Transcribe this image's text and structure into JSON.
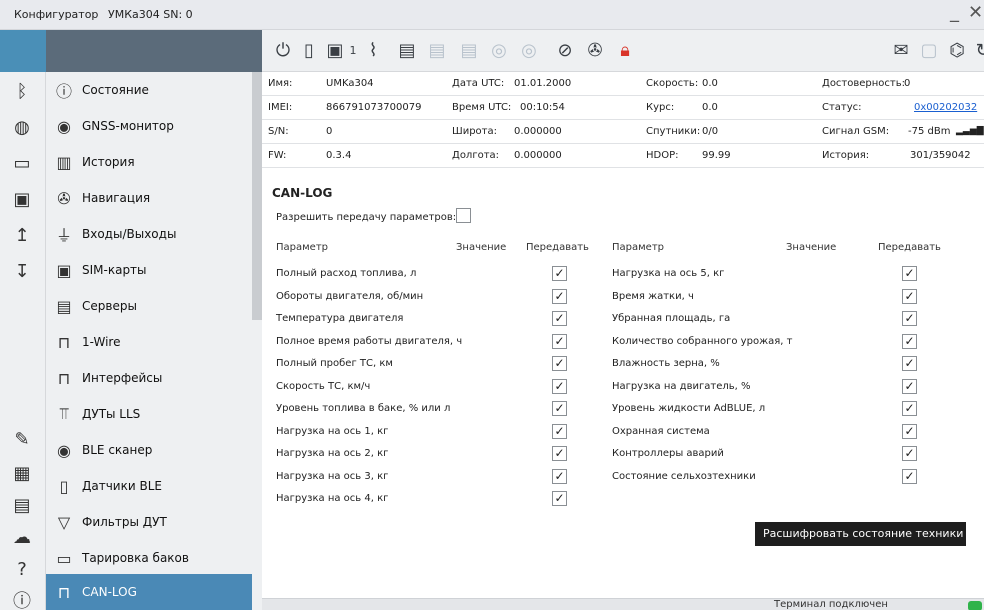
{
  "titlebar": {
    "app": "Конфигуратор",
    "device": "УМКа304 SN: 0",
    "minimize": "_",
    "close": "✕"
  },
  "toolbar_icons": [
    "power-icon",
    "battery-icon",
    "sim-icon",
    "antenna-icon",
    "server-icon",
    "server-dim-icon",
    "server-dim2-icon",
    "database-icon",
    "database2-icon",
    "no-location-icon",
    "satellite-icon",
    "lock-alert-icon",
    "envelope-icon",
    "document-icon",
    "satellite-dish-icon",
    "refresh-icon"
  ],
  "toolbar_sim_number": "1",
  "nav": [
    {
      "label": "Состояние",
      "icon": "info-icon"
    },
    {
      "label": "GNSS-монитор",
      "icon": "gnss-icon"
    },
    {
      "label": "История",
      "icon": "book-icon"
    },
    {
      "label": "Навигация",
      "icon": "satellite-nav-icon"
    },
    {
      "label": "Входы/Выходы",
      "icon": "plug-icon"
    },
    {
      "label": "SIM-карты",
      "icon": "sim-card-icon"
    },
    {
      "label": "Серверы",
      "icon": "server-icon"
    },
    {
      "label": "1-Wire",
      "icon": "connector-icon"
    },
    {
      "label": "Интерфейсы",
      "icon": "connector-icon"
    },
    {
      "label": "ДУТы LLS",
      "icon": "fuel-sensor-icon"
    },
    {
      "label": "BLE сканер",
      "icon": "bluetooth-scan-icon"
    },
    {
      "label": "Датчики BLE",
      "icon": "ble-sensor-icon"
    },
    {
      "label": "Фильтры ДУТ",
      "icon": "filter-icon"
    },
    {
      "label": "Тарировка баков",
      "icon": "tank-icon"
    },
    {
      "label": "CAN-LOG",
      "icon": "connector-icon"
    }
  ],
  "info": {
    "name_label": "Имя:",
    "name_value": "UMKa304",
    "imei_label": "IMEI:",
    "imei_value": "866791073700079",
    "sn_label": "S/N:",
    "sn_value": "0",
    "fw_label": "FW:",
    "fw_value": "0.3.4",
    "date_label": "Дата UTC:",
    "date_value": "01.01.2000",
    "time_label": "Время UTC:",
    "time_value": "00:10:54",
    "lat_label": "Широта:",
    "lat_value": "0.000000",
    "lon_label": "Долгота:",
    "lon_value": "0.000000",
    "speed_label": "Скорость:",
    "speed_value": "0.0",
    "course_label": "Курс:",
    "course_value": "0.0",
    "sats_label": "Спутники:",
    "sats_value": "0/0",
    "hdop_label": "HDOP:",
    "hdop_value": "99.99",
    "valid_label": "Достоверность:",
    "valid_value": "0",
    "status_label": "Статус:",
    "status_value": "0x00202032",
    "gsm_label": "Сигнал GSM:",
    "gsm_value": "-75 dBm",
    "history_label": "История:",
    "history_value": "301/359042"
  },
  "canlog": {
    "title": "CAN-LOG",
    "allow_label": "Разрешить передачу параметров:",
    "allow_checked": false,
    "col_param": "Параметр",
    "col_value": "Значение",
    "col_send": "Передавать",
    "left": [
      {
        "label": "Полный расход топлива, л",
        "value": "",
        "checked": true
      },
      {
        "label": "Обороты двигателя, об/мин",
        "value": "",
        "checked": true
      },
      {
        "label": "Температура двигателя",
        "value": "",
        "checked": true
      },
      {
        "label": "Полное время работы двигателя, ч",
        "value": "",
        "checked": true
      },
      {
        "label": "Полный пробег ТС, км",
        "value": "",
        "checked": true
      },
      {
        "label": "Скорость ТС, км/ч",
        "value": "",
        "checked": true
      },
      {
        "label": "Уровень топлива в баке, % или л",
        "value": "",
        "checked": true
      },
      {
        "label": "Нагрузка на ось 1, кг",
        "value": "",
        "checked": true
      },
      {
        "label": "Нагрузка на ось 2, кг",
        "value": "",
        "checked": true
      },
      {
        "label": "Нагрузка на ось 3, кг",
        "value": "",
        "checked": true
      },
      {
        "label": "Нагрузка на ось 4, кг",
        "value": "",
        "checked": true
      }
    ],
    "right": [
      {
        "label": "Нагрузка на ось 5, кг",
        "value": "",
        "checked": true
      },
      {
        "label": "Время жатки, ч",
        "value": "",
        "checked": true
      },
      {
        "label": "Убранная площадь, га",
        "value": "",
        "checked": true
      },
      {
        "label": "Количество собранного урожая, т",
        "value": "",
        "checked": true
      },
      {
        "label": "Влажность зерна, %",
        "value": "",
        "checked": true
      },
      {
        "label": "Нагрузка на двигатель, %",
        "value": "",
        "checked": true
      },
      {
        "label": "Уровень жидкости AdBLUE, л",
        "value": "",
        "checked": true
      },
      {
        "label": "Охранная система",
        "value": "",
        "checked": true
      },
      {
        "label": "Контроллеры аварий",
        "value": "",
        "checked": true
      },
      {
        "label": "Состояние сельхозтехники",
        "value": "",
        "checked": true
      }
    ]
  },
  "tooltip": "Расшифровать состояние техники",
  "status": {
    "text": "Терминал подключен"
  },
  "colors": {
    "accent": "#4a89b6",
    "link": "#1a5fd0",
    "ok": "#2fb34a",
    "danger": "#d9342a"
  }
}
